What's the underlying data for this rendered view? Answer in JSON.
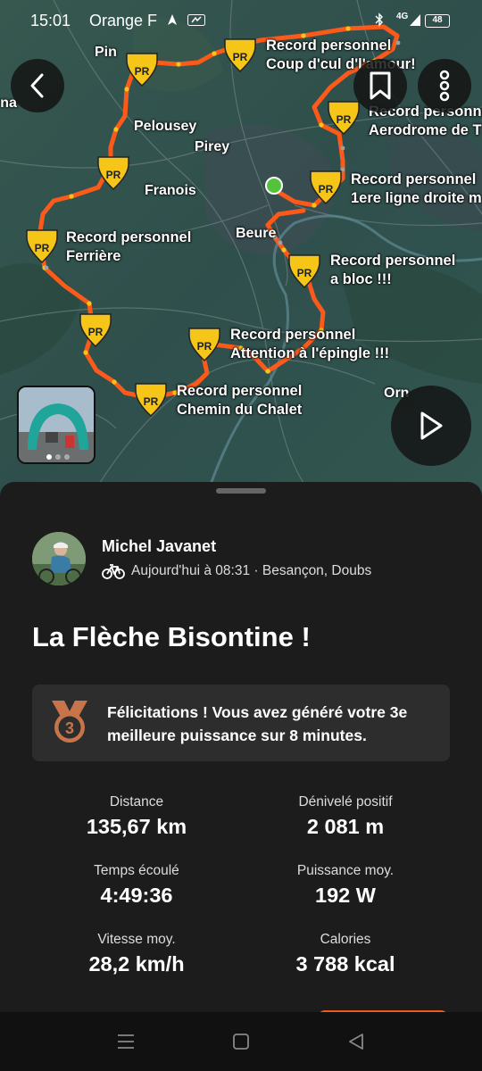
{
  "status_bar": {
    "time": "15:01",
    "carrier": "Orange F",
    "network": "4G",
    "battery": "48"
  },
  "map": {
    "places": [
      {
        "name": "Pin"
      },
      {
        "name": "rna"
      },
      {
        "name": "Pelousey"
      },
      {
        "name": "Pirey"
      },
      {
        "name": "Franois"
      },
      {
        "name": "Beure"
      },
      {
        "name": "Orn"
      }
    ],
    "pr_badge_text": "PR",
    "pr_labels": [
      {
        "line1": "Record personnel",
        "line2": "Coup d'cul d'l'amour!"
      },
      {
        "line1": "Record personnel",
        "line2": "Aerodrome de T"
      },
      {
        "line1": "Record personnel",
        "line2": "1ere ligne droite m"
      },
      {
        "line1": "Record personnel",
        "line2": "Ferrière"
      },
      {
        "line1": "Record personnel",
        "line2": "a bloc !!!"
      },
      {
        "line1": "Record personnel",
        "line2": "Attention à l'épingle !!!"
      },
      {
        "line1": "Record personnel",
        "line2": "Chemin du Chalet"
      }
    ],
    "route_color": "#fc5a1a",
    "badge_color": "#f5c518"
  },
  "activity": {
    "athlete": "Michel Javanet",
    "meta": "Aujourd'hui à 08:31 · Besançon, Doubs",
    "title": "La Flèche Bisontine !",
    "achievement": {
      "rank": "3",
      "text": "Félicitations ! Vous avez généré votre 3e meilleure puissance sur 8 minutes."
    },
    "stats": [
      {
        "label": "Distance",
        "value": "135,67 km"
      },
      {
        "label": "Dénivelé positif",
        "value": "2 081 m"
      },
      {
        "label": "Temps écoulé",
        "value": "4:49:36"
      },
      {
        "label": "Puissance moy.",
        "value": "192 W"
      },
      {
        "label": "Vitesse moy.",
        "value": "28,2 km/h"
      },
      {
        "label": "Calories",
        "value": "3 788 kcal"
      }
    ]
  }
}
